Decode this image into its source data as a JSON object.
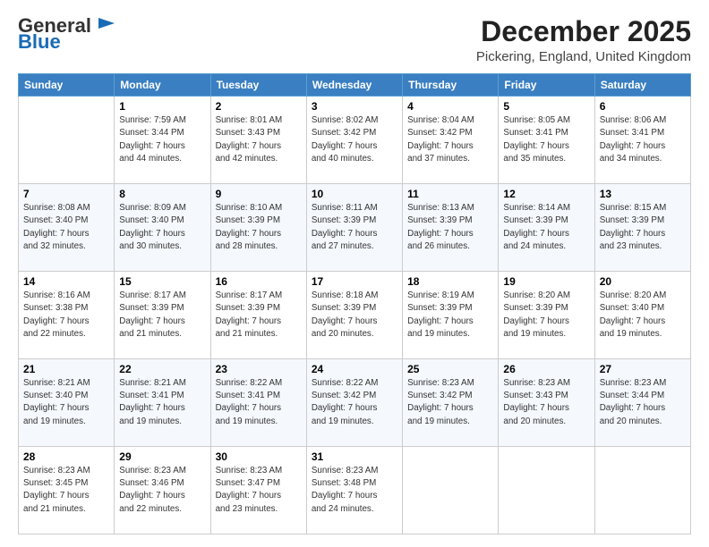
{
  "header": {
    "logo_general": "General",
    "logo_blue": "Blue",
    "month_title": "December 2025",
    "location": "Pickering, England, United Kingdom"
  },
  "days_of_week": [
    "Sunday",
    "Monday",
    "Tuesday",
    "Wednesday",
    "Thursday",
    "Friday",
    "Saturday"
  ],
  "weeks": [
    [
      {
        "day": "",
        "info": ""
      },
      {
        "day": "1",
        "info": "Sunrise: 7:59 AM\nSunset: 3:44 PM\nDaylight: 7 hours\nand 44 minutes."
      },
      {
        "day": "2",
        "info": "Sunrise: 8:01 AM\nSunset: 3:43 PM\nDaylight: 7 hours\nand 42 minutes."
      },
      {
        "day": "3",
        "info": "Sunrise: 8:02 AM\nSunset: 3:42 PM\nDaylight: 7 hours\nand 40 minutes."
      },
      {
        "day": "4",
        "info": "Sunrise: 8:04 AM\nSunset: 3:42 PM\nDaylight: 7 hours\nand 37 minutes."
      },
      {
        "day": "5",
        "info": "Sunrise: 8:05 AM\nSunset: 3:41 PM\nDaylight: 7 hours\nand 35 minutes."
      },
      {
        "day": "6",
        "info": "Sunrise: 8:06 AM\nSunset: 3:41 PM\nDaylight: 7 hours\nand 34 minutes."
      }
    ],
    [
      {
        "day": "7",
        "info": "Sunrise: 8:08 AM\nSunset: 3:40 PM\nDaylight: 7 hours\nand 32 minutes."
      },
      {
        "day": "8",
        "info": "Sunrise: 8:09 AM\nSunset: 3:40 PM\nDaylight: 7 hours\nand 30 minutes."
      },
      {
        "day": "9",
        "info": "Sunrise: 8:10 AM\nSunset: 3:39 PM\nDaylight: 7 hours\nand 28 minutes."
      },
      {
        "day": "10",
        "info": "Sunrise: 8:11 AM\nSunset: 3:39 PM\nDaylight: 7 hours\nand 27 minutes."
      },
      {
        "day": "11",
        "info": "Sunrise: 8:13 AM\nSunset: 3:39 PM\nDaylight: 7 hours\nand 26 minutes."
      },
      {
        "day": "12",
        "info": "Sunrise: 8:14 AM\nSunset: 3:39 PM\nDaylight: 7 hours\nand 24 minutes."
      },
      {
        "day": "13",
        "info": "Sunrise: 8:15 AM\nSunset: 3:39 PM\nDaylight: 7 hours\nand 23 minutes."
      }
    ],
    [
      {
        "day": "14",
        "info": "Sunrise: 8:16 AM\nSunset: 3:38 PM\nDaylight: 7 hours\nand 22 minutes."
      },
      {
        "day": "15",
        "info": "Sunrise: 8:17 AM\nSunset: 3:39 PM\nDaylight: 7 hours\nand 21 minutes."
      },
      {
        "day": "16",
        "info": "Sunrise: 8:17 AM\nSunset: 3:39 PM\nDaylight: 7 hours\nand 21 minutes."
      },
      {
        "day": "17",
        "info": "Sunrise: 8:18 AM\nSunset: 3:39 PM\nDaylight: 7 hours\nand 20 minutes."
      },
      {
        "day": "18",
        "info": "Sunrise: 8:19 AM\nSunset: 3:39 PM\nDaylight: 7 hours\nand 19 minutes."
      },
      {
        "day": "19",
        "info": "Sunrise: 8:20 AM\nSunset: 3:39 PM\nDaylight: 7 hours\nand 19 minutes."
      },
      {
        "day": "20",
        "info": "Sunrise: 8:20 AM\nSunset: 3:40 PM\nDaylight: 7 hours\nand 19 minutes."
      }
    ],
    [
      {
        "day": "21",
        "info": "Sunrise: 8:21 AM\nSunset: 3:40 PM\nDaylight: 7 hours\nand 19 minutes."
      },
      {
        "day": "22",
        "info": "Sunrise: 8:21 AM\nSunset: 3:41 PM\nDaylight: 7 hours\nand 19 minutes."
      },
      {
        "day": "23",
        "info": "Sunrise: 8:22 AM\nSunset: 3:41 PM\nDaylight: 7 hours\nand 19 minutes."
      },
      {
        "day": "24",
        "info": "Sunrise: 8:22 AM\nSunset: 3:42 PM\nDaylight: 7 hours\nand 19 minutes."
      },
      {
        "day": "25",
        "info": "Sunrise: 8:23 AM\nSunset: 3:42 PM\nDaylight: 7 hours\nand 19 minutes."
      },
      {
        "day": "26",
        "info": "Sunrise: 8:23 AM\nSunset: 3:43 PM\nDaylight: 7 hours\nand 20 minutes."
      },
      {
        "day": "27",
        "info": "Sunrise: 8:23 AM\nSunset: 3:44 PM\nDaylight: 7 hours\nand 20 minutes."
      }
    ],
    [
      {
        "day": "28",
        "info": "Sunrise: 8:23 AM\nSunset: 3:45 PM\nDaylight: 7 hours\nand 21 minutes."
      },
      {
        "day": "29",
        "info": "Sunrise: 8:23 AM\nSunset: 3:46 PM\nDaylight: 7 hours\nand 22 minutes."
      },
      {
        "day": "30",
        "info": "Sunrise: 8:23 AM\nSunset: 3:47 PM\nDaylight: 7 hours\nand 23 minutes."
      },
      {
        "day": "31",
        "info": "Sunrise: 8:23 AM\nSunset: 3:48 PM\nDaylight: 7 hours\nand 24 minutes."
      },
      {
        "day": "",
        "info": ""
      },
      {
        "day": "",
        "info": ""
      },
      {
        "day": "",
        "info": ""
      }
    ]
  ]
}
